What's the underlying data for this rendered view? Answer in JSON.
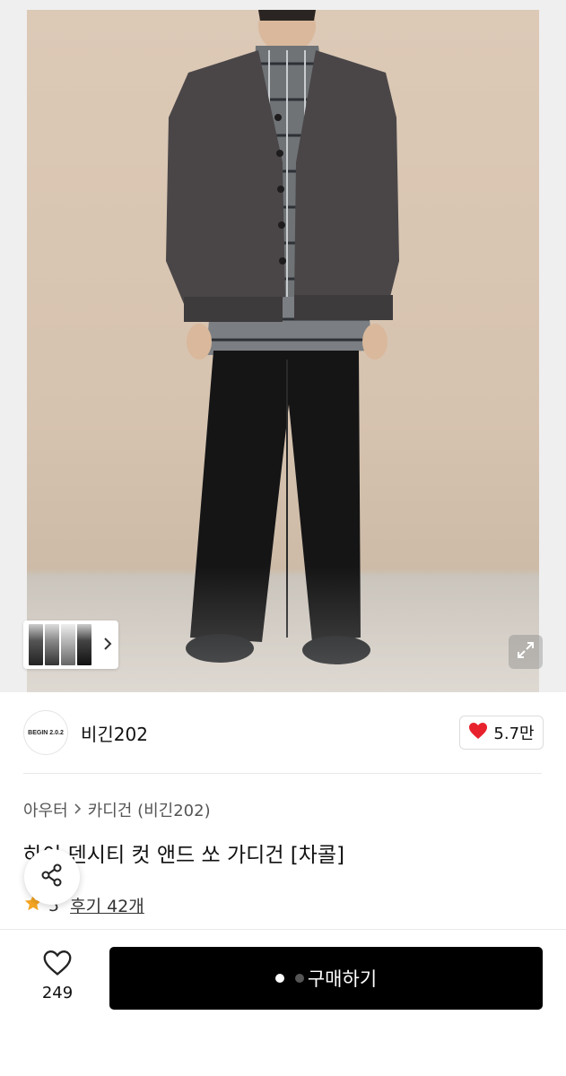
{
  "brand": {
    "logo_text": "BEGIN 2.0.2",
    "name": "비긴202",
    "likes": "5.7만"
  },
  "breadcrumb": {
    "category": "아우터",
    "subcategory": "카디건 (비긴202)"
  },
  "product": {
    "title": "하이 덴시티 컷 앤드 쏘 가디건 [차콜]",
    "rating": "5",
    "reviews": "후기 42개"
  },
  "bottom": {
    "wish_count": "249",
    "buy_label": "구매하기"
  },
  "icons": [
    "chevron-right-icon",
    "expand-icon",
    "heart-filled-icon",
    "share-icon",
    "star-icon",
    "heart-outline-icon"
  ],
  "colors": {
    "accent_heart": "#e8222d",
    "star": "#f5a623",
    "buy_button": "#000000"
  }
}
